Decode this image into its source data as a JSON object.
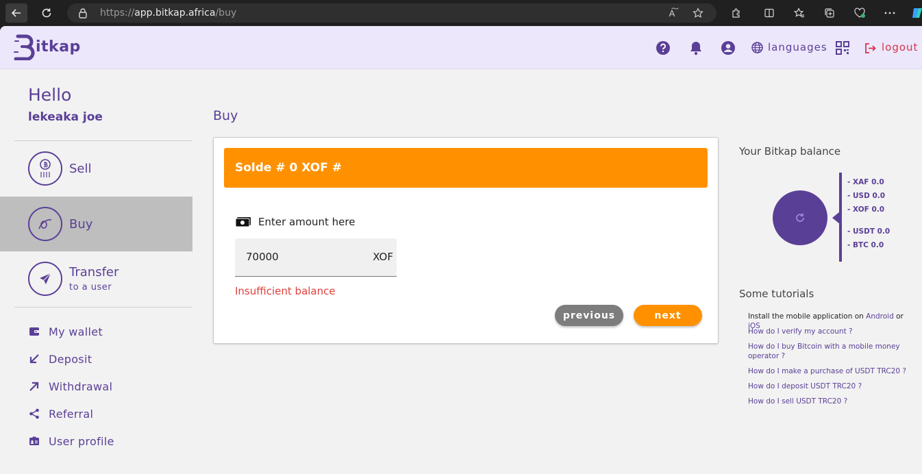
{
  "browser": {
    "url_prefix": "https://",
    "url_host": "app.bitkap.africa",
    "url_path": "/buy"
  },
  "header": {
    "logo_text": "itkap",
    "languages_label": "languages",
    "logout_label": "logout"
  },
  "sidebar": {
    "greeting": "Hello",
    "username": "lekeaka joe",
    "main_items": [
      {
        "label": "Sell"
      },
      {
        "label": "Buy"
      },
      {
        "label": "Transfer",
        "sub": "to a user"
      }
    ],
    "menu": [
      {
        "label": "My wallet"
      },
      {
        "label": "Deposit"
      },
      {
        "label": "Withdrawal"
      },
      {
        "label": "Referral"
      },
      {
        "label": "User profile"
      }
    ]
  },
  "main": {
    "title": "Buy",
    "banner": "Solde # 0 XOF #",
    "amount_label": "Enter amount here",
    "amount_value": "70000",
    "amount_currency": "XOF",
    "error": "Insufficient balance",
    "previous_label": "previous",
    "next_label": "next"
  },
  "balance": {
    "title": "Your Bitkap balance",
    "lines": [
      "- XAF 0.0",
      "- USD 0.0",
      "- XOF 0.0",
      "- USDT 0.0",
      "- BTC 0.0"
    ]
  },
  "tutorials": {
    "title": "Some tutorials",
    "install_prefix": "Install the mobile application on ",
    "android": "Android",
    "or": " or ",
    "ios": "iOS",
    "items": [
      "How do I verify my account ?",
      "How do I buy Bitcoin with a mobile money operator ?",
      "How do I make a purchase of USDT TRC20 ?",
      "How do I deposit USDT TRC20 ?",
      "How do I sell USDT TRC20 ?"
    ]
  },
  "colors": {
    "brand": "#5a3f96",
    "accent": "#ff9100",
    "error": "#e0403a",
    "logout": "#d6334a"
  }
}
